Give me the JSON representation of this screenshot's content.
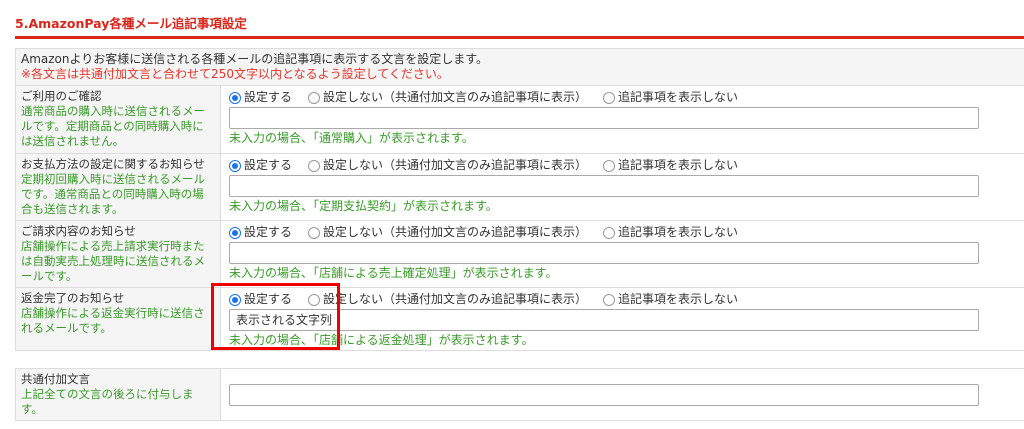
{
  "title": "5.AmazonPay各種メール追記事項設定",
  "intro": {
    "line1": "Amazonよりお客様に送信される各種メールの追記事項に表示する文言を設定します。",
    "line2": "※各文言は共通付加文言と合わせて250文字以内となるよう設定してください。"
  },
  "radio_labels": {
    "set": "設定する",
    "not_set": "設定しない（共通付加文言のみ追記事項に表示）",
    "hide": "追記事項を表示しない"
  },
  "rows": [
    {
      "name": "ご利用のご確認",
      "desc": "通常商品の購入時に送信されるメールです。定期商品との同時購入時には送信されません。",
      "value": "",
      "hint": "未入力の場合、「通常購入」が表示されます。",
      "selected": "set"
    },
    {
      "name": "お支払方法の設定に関するお知らせ",
      "desc": "定期初回購入時に送信されるメールです。通常商品との同時購入時の場合も送信されます。",
      "value": "",
      "hint": "未入力の場合、「定期支払契約」が表示されます。",
      "selected": "set"
    },
    {
      "name": "ご請求内容のお知らせ",
      "desc": "店舗操作による売上請求実行時または自動実売上処理時に送信されるメールです。",
      "value": "",
      "hint": "未入力の場合、「店舗による売上確定処理」が表示されます。",
      "selected": "set"
    },
    {
      "name": "返金完了のお知らせ",
      "desc": "店舗操作による返金実行時に送信されるメールです。",
      "value": "表示される文字列",
      "hint": "未入力の場合、「店舗による返金処理」が表示されます。",
      "selected": "set"
    }
  ],
  "common": {
    "name": "共通付加文言",
    "desc": "上記全ての文言の後ろに付与します。",
    "value": ""
  },
  "colors": {
    "accent": "#d9261c",
    "green": "#3a9a2a",
    "radio": "#1a73e8"
  }
}
